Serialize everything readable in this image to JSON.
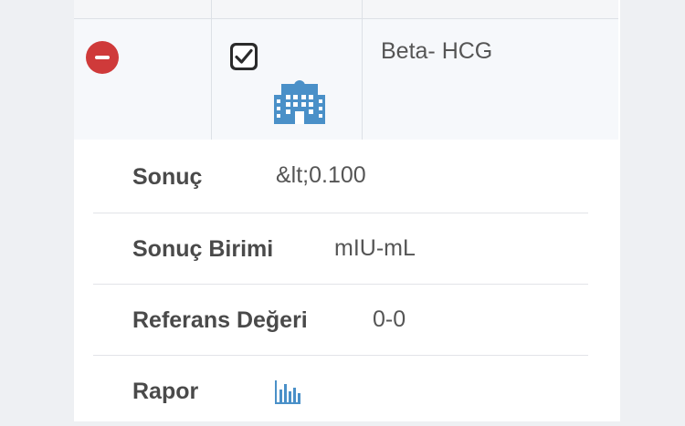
{
  "test": {
    "name": "Beta- HCG",
    "selected": true,
    "icons": {
      "remove": "minus-circle-icon",
      "checkbox": "checkmark-icon",
      "hospital": "hospital-building-icon",
      "report": "bar-chart-icon"
    },
    "colors": {
      "remove": "#cf3a3a",
      "hospital": "#4a90c8",
      "report": "#4a90c8"
    }
  },
  "details": [
    {
      "label": "Sonuç",
      "value": "&lt;0.100"
    },
    {
      "label": "Sonuç Birimi",
      "value": "mIU-mL"
    },
    {
      "label": "Referans Değeri",
      "value": "0-0"
    },
    {
      "label": "Rapor",
      "value": ""
    }
  ]
}
